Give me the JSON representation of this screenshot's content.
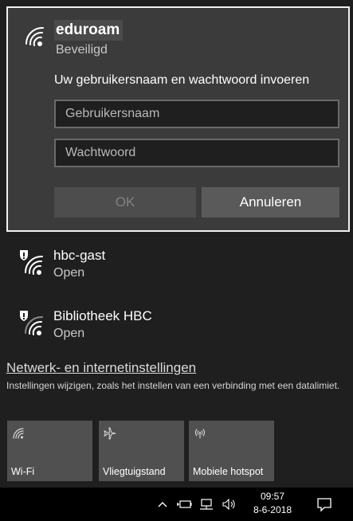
{
  "selected_network": {
    "name": "eduroam",
    "status": "Beveiligd",
    "prompt": "Uw gebruikersnaam en wachtwoord invoeren",
    "username_placeholder": "Gebruikersnaam",
    "password_placeholder": "Wachtwoord",
    "ok_label": "OK",
    "cancel_label": "Annuleren"
  },
  "networks": [
    {
      "name": "hbc-gast",
      "status": "Open"
    },
    {
      "name": "Bibliotheek HBC",
      "status": "Open"
    }
  ],
  "settings": {
    "link": "Netwerk- en internetinstellingen",
    "description": "Instellingen wijzigen, zoals het instellen van een verbinding met een datalimiet."
  },
  "quick_actions": [
    {
      "label": "Wi-Fi",
      "icon": "wifi-icon"
    },
    {
      "label": "Vliegtuigstand",
      "icon": "airplane-icon"
    },
    {
      "label": "Mobiele hotspot",
      "icon": "hotspot-icon"
    }
  ],
  "taskbar": {
    "time": "09:57",
    "date": "8-6-2018"
  },
  "colors": {
    "flyout_bg": "#1f1f1f",
    "panel_bg": "#3b3b3b",
    "tile_bg": "#505050",
    "taskbar_bg": "#000000"
  }
}
